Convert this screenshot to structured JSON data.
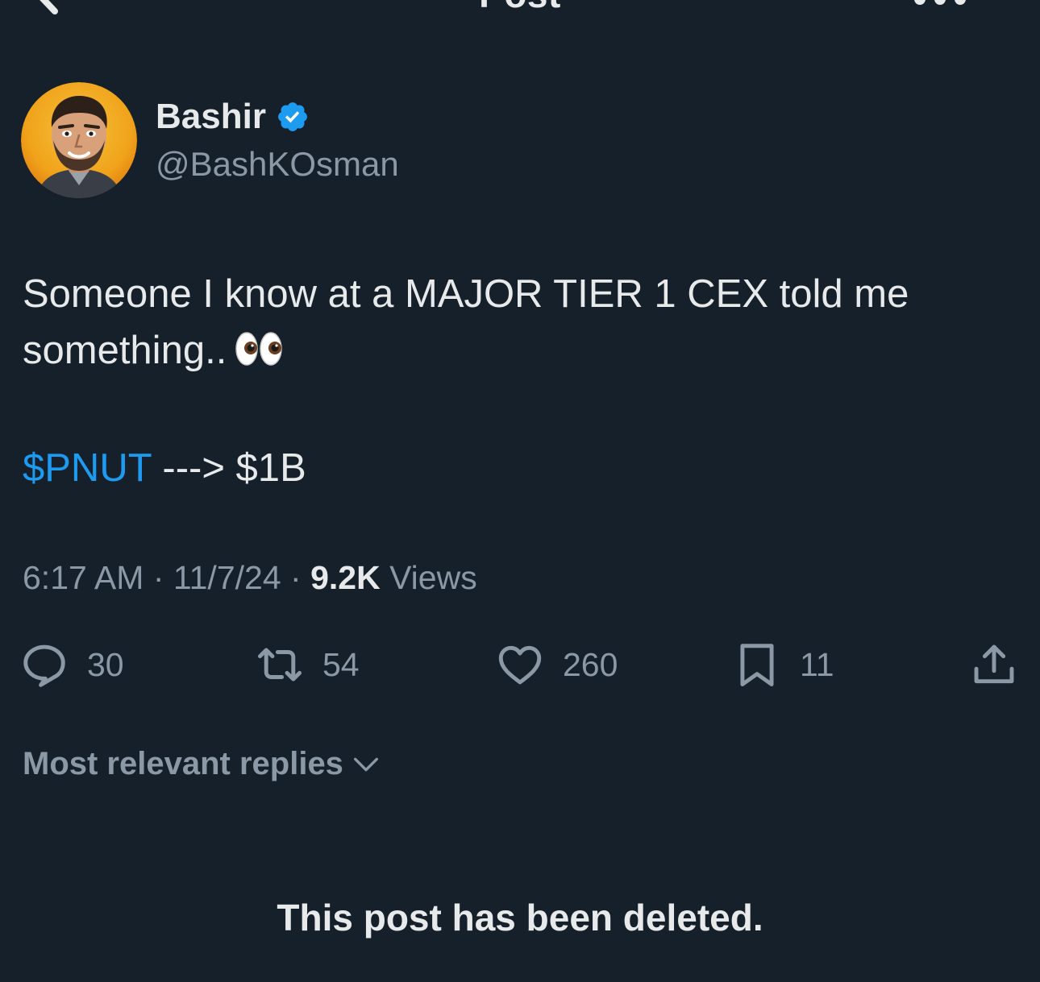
{
  "header": {
    "title": "Post",
    "back_icon": "arrow-left-icon",
    "more_icon": "more-horizontal-icon"
  },
  "author": {
    "display_name": "Bashir",
    "handle": "@BashKOsman",
    "verified": true,
    "verified_color": "#1d9bf0"
  },
  "tweet": {
    "line1": "Someone I know at a MAJOR TIER 1 CEX told me something..",
    "emoji": "eyes",
    "cashtag": "$PNUT",
    "line2_rest": " ---> $1B"
  },
  "meta": {
    "time": "6:17 AM",
    "sep1": " · ",
    "date": "11/7/24",
    "sep2": " · ",
    "views_count": "9.2K",
    "views_label": " Views"
  },
  "actions": {
    "replies": "30",
    "reposts": "54",
    "likes": "260",
    "bookmarks": "11"
  },
  "replies_sort": {
    "label": "Most relevant replies"
  },
  "notice": "This post has been deleted.",
  "colors": {
    "background": "#15202b",
    "primary_text": "#e7e9ea",
    "secondary_text": "#8b98a5",
    "accent": "#1d9bf0"
  }
}
